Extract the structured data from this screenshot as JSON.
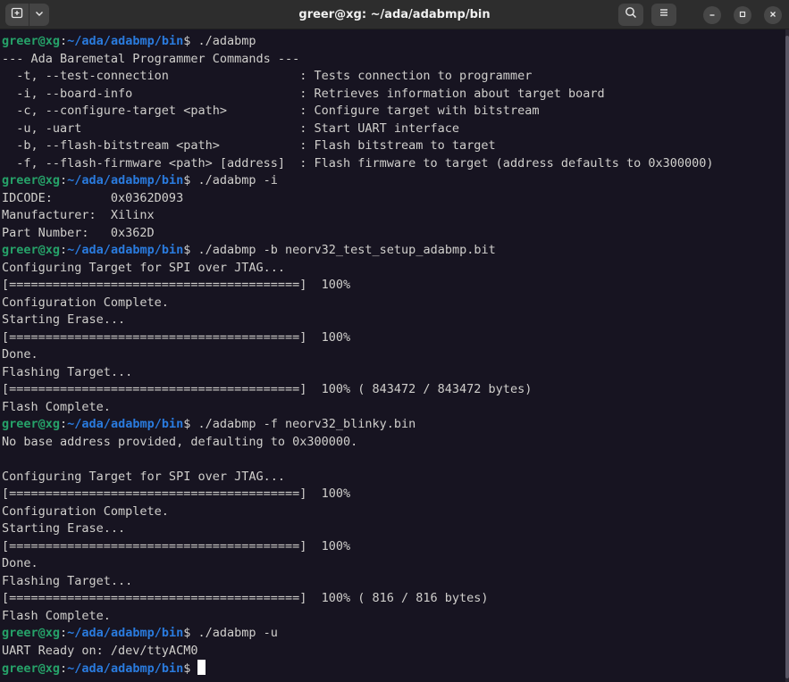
{
  "window": {
    "title": "greer@xg: ~/ada/adabmp/bin",
    "icons": {
      "new_tab": "new-tab-icon",
      "dropdown": "chevron-down-icon",
      "search": "search-icon",
      "menu": "hamburger-menu-icon",
      "minimize": "minimize-icon",
      "maximize": "maximize-icon",
      "close": "close-icon"
    }
  },
  "colors": {
    "background": "#171421",
    "text": "#d0cfcc",
    "prompt_user": "#26a269",
    "prompt_path": "#2a7bde"
  },
  "prompt": {
    "user": "greer@xg",
    "sep": ":",
    "path": "~/ada/adabmp/bin",
    "symbol": "$ "
  },
  "lines": [
    {
      "type": "cmd",
      "text": "./adabmp"
    },
    {
      "type": "out",
      "text": "--- Ada Baremetal Programmer Commands ---"
    },
    {
      "type": "out",
      "text": "  -t, --test-connection                  : Tests connection to programmer"
    },
    {
      "type": "out",
      "text": "  -i, --board-info                       : Retrieves information about target board"
    },
    {
      "type": "out",
      "text": "  -c, --configure-target <path>          : Configure target with bitstream"
    },
    {
      "type": "out",
      "text": "  -u, -uart                              : Start UART interface"
    },
    {
      "type": "out",
      "text": "  -b, --flash-bitstream <path>           : Flash bitstream to target"
    },
    {
      "type": "out",
      "text": "  -f, --flash-firmware <path> [address]  : Flash firmware to target (address defaults to 0x300000)"
    },
    {
      "type": "cmd",
      "text": "./adabmp -i"
    },
    {
      "type": "out",
      "text": "IDCODE:        0x0362D093"
    },
    {
      "type": "out",
      "text": "Manufacturer:  Xilinx"
    },
    {
      "type": "out",
      "text": "Part Number:   0x362D"
    },
    {
      "type": "cmd",
      "text": "./adabmp -b neorv32_test_setup_adabmp.bit"
    },
    {
      "type": "out",
      "text": "Configuring Target for SPI over JTAG..."
    },
    {
      "type": "out",
      "text": "[========================================]  100%"
    },
    {
      "type": "out",
      "text": "Configuration Complete."
    },
    {
      "type": "out",
      "text": "Starting Erase..."
    },
    {
      "type": "out",
      "text": "[========================================]  100%"
    },
    {
      "type": "out",
      "text": "Done."
    },
    {
      "type": "out",
      "text": "Flashing Target..."
    },
    {
      "type": "out",
      "text": "[========================================]  100% ( 843472 / 843472 bytes)"
    },
    {
      "type": "out",
      "text": "Flash Complete."
    },
    {
      "type": "cmd",
      "text": "./adabmp -f neorv32_blinky.bin"
    },
    {
      "type": "out",
      "text": "No base address provided, defaulting to 0x300000."
    },
    {
      "type": "out",
      "text": ""
    },
    {
      "type": "out",
      "text": "Configuring Target for SPI over JTAG..."
    },
    {
      "type": "out",
      "text": "[========================================]  100%"
    },
    {
      "type": "out",
      "text": "Configuration Complete."
    },
    {
      "type": "out",
      "text": "Starting Erase..."
    },
    {
      "type": "out",
      "text": "[========================================]  100%"
    },
    {
      "type": "out",
      "text": "Done."
    },
    {
      "type": "out",
      "text": "Flashing Target..."
    },
    {
      "type": "out",
      "text": "[========================================]  100% ( 816 / 816 bytes)"
    },
    {
      "type": "out",
      "text": "Flash Complete."
    },
    {
      "type": "cmd",
      "text": "./adabmp -u"
    },
    {
      "type": "out",
      "text": "UART Ready on: /dev/ttyACM0"
    },
    {
      "type": "cmd",
      "text": "",
      "cursor": true
    }
  ]
}
